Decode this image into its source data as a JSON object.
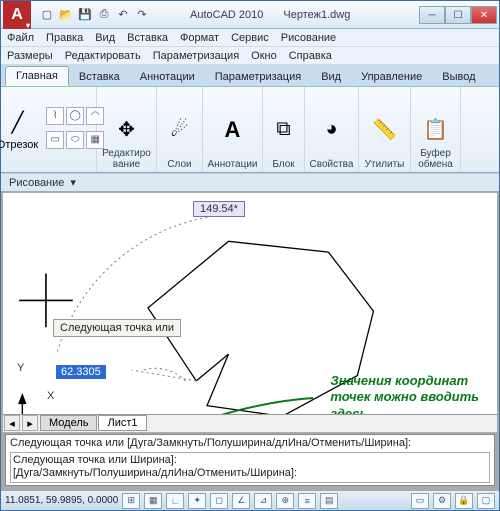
{
  "app": {
    "name": "AutoCAD 2010",
    "doc": "Чертеж1.dwg"
  },
  "qat": [
    "file",
    "open",
    "save",
    "print",
    "undo",
    "redo"
  ],
  "menus": {
    "row1": [
      "Файл",
      "Правка",
      "Вид",
      "Вставка",
      "Формат",
      "Сервис",
      "Рисование"
    ],
    "row2": [
      "Размеры",
      "Редактировать",
      "Параметризация",
      "Окно",
      "Справка"
    ]
  },
  "ribbon_tabs": [
    "Главная",
    "Вставка",
    "Аннотации",
    "Параметризация",
    "Вид",
    "Управление",
    "Вывод"
  ],
  "ribbon_active": 0,
  "panels": {
    "draw": {
      "main": "Отрезок",
      "dropdown": "Рисование"
    },
    "edit": {
      "label": "Редактиро\nвание"
    },
    "layers": {
      "label": "Слои"
    },
    "ann": {
      "label": "Аннотации"
    },
    "block": {
      "label": "Блок"
    },
    "props": {
      "label": "Свойства"
    },
    "util": {
      "label": "Утилиты"
    },
    "clip": {
      "label": "Буфер\nобмена"
    }
  },
  "canvas": {
    "angle": "149.54*",
    "dyn_prompt": "Следующая точка или",
    "length": "62.3305",
    "annotation": "Значения координат\nточек можно вводить\nздесь"
  },
  "view_tabs": {
    "model": "Модель",
    "sheet1": "Лист1"
  },
  "command": {
    "hist1": "Следующая точка или [Дуга/Замкнуть/Полуширина/длИна/Отменить/Ширина]:",
    "hist2": " Следующая точка или                                                    Ширина]:",
    "opts": "[Дуга/Замкнуть/Полуширина/длИна/Отменить/Ширина]:"
  },
  "status": {
    "coords": "11.0851, 59.9895, 0.0000"
  },
  "colors": {
    "accent": "#2a6bd4",
    "green": "#0a7a1a"
  }
}
